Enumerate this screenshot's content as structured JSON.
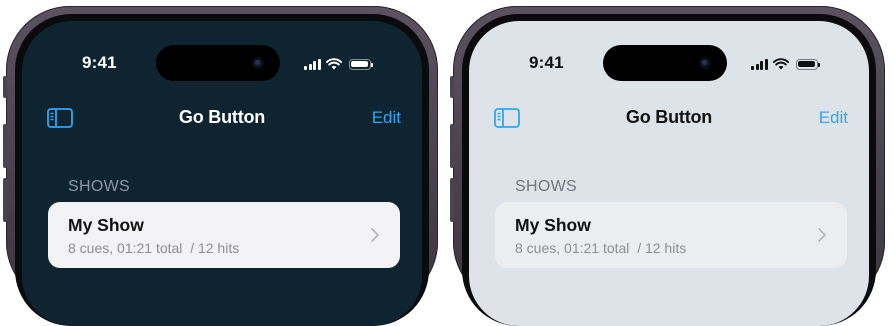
{
  "colors": {
    "accent": "#2fa7f0",
    "dark_background": "#0e2430",
    "light_background": "#dde3e9",
    "row_background": "#f3f3f5"
  },
  "screens": [
    {
      "appearance": "dark",
      "status_bar": {
        "time": "9:41",
        "icons": [
          "signal-icon",
          "wifi-icon",
          "battery-icon"
        ]
      },
      "nav": {
        "left_icon": "sidebar-icon",
        "title": "Go Button",
        "edit_label": "Edit"
      },
      "section": {
        "header": "SHOWS"
      },
      "show_row": {
        "title": "My Show",
        "subtitle": "8 cues, 01:21 total  / 12 hits",
        "trailing_icon": "chevron-right-icon"
      }
    },
    {
      "appearance": "light",
      "status_bar": {
        "time": "9:41",
        "icons": [
          "signal-icon",
          "wifi-icon",
          "battery-icon"
        ]
      },
      "nav": {
        "left_icon": "sidebar-icon",
        "title": "Go Button",
        "edit_label": "Edit"
      },
      "section": {
        "header": "SHOWS"
      },
      "show_row": {
        "title": "My Show",
        "subtitle": "8 cues, 01:21 total  / 12 hits",
        "trailing_icon": "chevron-right-icon"
      }
    }
  ]
}
